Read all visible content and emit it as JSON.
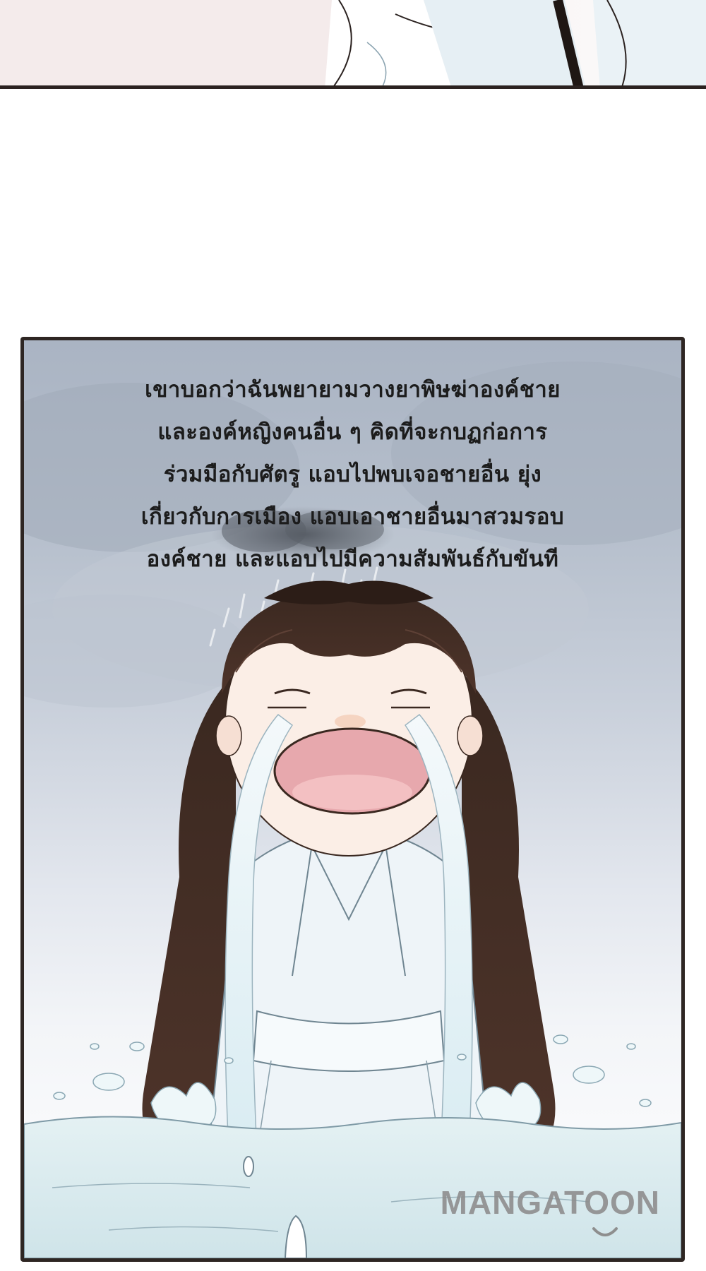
{
  "caption": {
    "lines": [
      "เขาบอกว่าฉันพยายามวางยาพิษฆ่าองค์ชาย",
      "และองค์หญิงคนอื่น ๆ คิดที่จะกบฏก่อการ",
      "ร่วมมือกับศัตรู แอบไปพบเจอชายอื่น ยุ่ง",
      "เกี่ยวกับการเมือง แอบเอาชายอื่นมาสวมรอบ",
      "องค์ชาย และแอบไปมีความสัมพันธ์กับขันที"
    ]
  },
  "watermark": {
    "text": "MANGATOON"
  },
  "colors": {
    "panel_border": "#2e2623",
    "sky": "#aab4c3",
    "hair": "#4a3128",
    "robe": "#eef4f8",
    "water": "#d6eaee",
    "mouth": "#e7a8ad",
    "skin": "#fbeee6"
  }
}
